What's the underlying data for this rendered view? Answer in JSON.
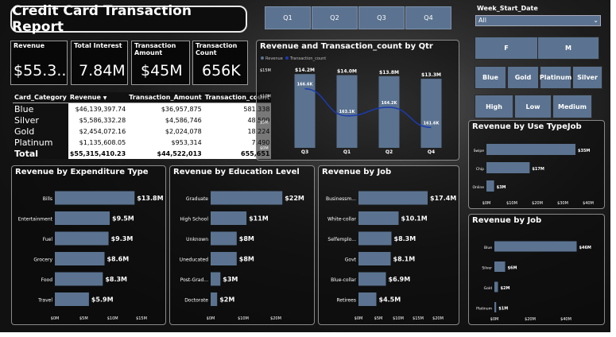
{
  "title": "Credit Card Transaction Report",
  "kpis": [
    {
      "label": "Revenue",
      "value": "$55.3..."
    },
    {
      "label": "Total Interest",
      "value": "7.84M"
    },
    {
      "label": "Transaction Amount",
      "value": "$45M"
    },
    {
      "label": "Transaction Count",
      "value": "656K"
    }
  ],
  "quarter_slicer": [
    "Q1",
    "Q2",
    "Q3",
    "Q4"
  ],
  "week_filter": {
    "label": "Week_Start_Date",
    "value": "All"
  },
  "gender_slicer": [
    "F",
    "M"
  ],
  "card_slicer": [
    "Blue",
    "Gold",
    "Platinum",
    "Silver"
  ],
  "income_slicer": [
    "High",
    "Low",
    "Medium"
  ],
  "table": {
    "headers": [
      "Card_Category",
      "Revenue",
      "Transaction_Amount",
      "Transaction_count"
    ],
    "rows": [
      [
        "Blue",
        "$46,139,397.74",
        "$36,957,875",
        "581,338"
      ],
      [
        "Silver",
        "$5,586,332.28",
        "$4,586,746",
        "48,599"
      ],
      [
        "Gold",
        "$2,454,072.16",
        "$2,024,078",
        "18,224"
      ],
      [
        "Platinum",
        "$1,135,608.05",
        "$953,314",
        "7,490"
      ]
    ],
    "total": [
      "Total",
      "$55,315,410.23",
      "$44,522,013",
      "655,651"
    ]
  },
  "chart_data": [
    {
      "type": "bar",
      "title": "Revenue and Transaction_count by Qtr",
      "legend": [
        "Revenue",
        "Transaction_count"
      ],
      "categories": [
        "Q3",
        "Q1",
        "Q2",
        "Q4"
      ],
      "series": [
        {
          "name": "Revenue",
          "values": [
            14.2,
            14.0,
            13.8,
            13.3
          ],
          "labels": [
            "$14.2M",
            "$14.0M",
            "$13.8M",
            "$13.3M"
          ]
        },
        {
          "name": "Transaction_count",
          "values": [
            166.6,
            163.1,
            164.2,
            161.6
          ],
          "labels": [
            "166.6K",
            "163.1K",
            "164.2K",
            "161.6K"
          ]
        }
      ],
      "ylim": [
        0,
        15
      ],
      "yticks": [
        "$0M",
        "$5M",
        "$10M",
        "$15M"
      ]
    },
    {
      "type": "bar",
      "title": "Revenue by Expenditure Type",
      "categories": [
        "Bills",
        "Entertainment",
        "Fuel",
        "Grocery",
        "Food",
        "Travel"
      ],
      "values": [
        13.8,
        9.5,
        9.3,
        8.6,
        8.3,
        5.9
      ],
      "labels": [
        "$13.8M",
        "$9.5M",
        "$9.3M",
        "$8.6M",
        "$8.3M",
        "$5.9M"
      ],
      "xlim": [
        0,
        15
      ],
      "xticks": [
        "$0M",
        "$5M",
        "$10M",
        "$15M"
      ]
    },
    {
      "type": "bar",
      "title": "Revenue by Education Level",
      "categories": [
        "Graduate",
        "High School",
        "Unknown",
        "Uneducated",
        "Post-Grad...",
        "Doctorate"
      ],
      "values": [
        22,
        11,
        8,
        8,
        3,
        2
      ],
      "labels": [
        "$22M",
        "$11M",
        "$8M",
        "$8M",
        "$3M",
        "$2M"
      ],
      "xlim": [
        0,
        20
      ],
      "xticks": [
        "$0M",
        "$10M",
        "$20M"
      ]
    },
    {
      "type": "bar",
      "title": "Revenue by Job",
      "categories": [
        "Businessm...",
        "White-collar",
        "Selfemplo...",
        "Govt",
        "Blue-collar",
        "Retirees"
      ],
      "values": [
        17.4,
        10.1,
        8.3,
        8.1,
        6.9,
        4.5
      ],
      "labels": [
        "$17.4M",
        "$10.1M",
        "$8.3M",
        "$8.1M",
        "$6.9M",
        "$4.5M"
      ],
      "xlim": [
        0,
        20
      ],
      "xticks": [
        "$0M",
        "$5M",
        "$10M",
        "$15M",
        "$20M"
      ]
    },
    {
      "type": "bar",
      "title": "Revenue by Use TypeJob",
      "categories": [
        "Swipe",
        "Chip",
        "Online"
      ],
      "values": [
        35,
        17,
        3
      ],
      "labels": [
        "$35M",
        "$17M",
        "$3M"
      ],
      "xlim": [
        0,
        40
      ],
      "xticks": [
        "$0M",
        "$10M",
        "$20M",
        "$30M",
        "$40M"
      ]
    },
    {
      "type": "bar",
      "title": "Revenue by Job",
      "categories": [
        "Blue",
        "Silver",
        "Gold",
        "Platinum"
      ],
      "values": [
        46,
        6,
        2,
        1
      ],
      "labels": [
        "$46M",
        "$6M",
        "$2M",
        "$1M"
      ],
      "xlim": [
        0,
        40
      ],
      "xticks": [
        "$0M",
        "$20M",
        "$40M"
      ]
    }
  ],
  "colors": {
    "bar": "#5b7390",
    "line": "#1a3bb0",
    "slicer": "#5b7390"
  }
}
